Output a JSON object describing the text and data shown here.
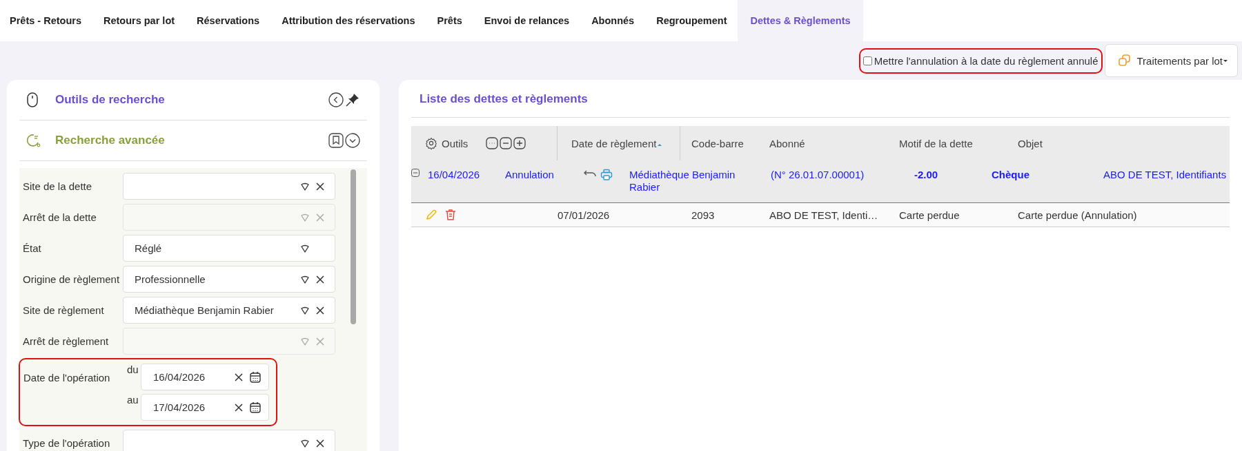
{
  "tabs": [
    {
      "label": "Prêts - Retours",
      "selected": false
    },
    {
      "label": "Retours par lot",
      "selected": false
    },
    {
      "label": "Réservations",
      "selected": false
    },
    {
      "label": "Attribution des réservations",
      "selected": false
    },
    {
      "label": "Prêts",
      "selected": false
    },
    {
      "label": "Envoi de relances",
      "selected": false
    },
    {
      "label": "Abonnés",
      "selected": false
    },
    {
      "label": "Regroupement",
      "selected": false
    },
    {
      "label": "Dettes & Règlements",
      "selected": true
    }
  ],
  "toolbar": {
    "option": {
      "label": "Mettre l'annulation à la date du règlement annulé",
      "checked": false,
      "highlighted": true
    },
    "batch_button": "Traitements par lot"
  },
  "search_panel": {
    "title": "Outils de recherche",
    "section_title": "Recherche avancée",
    "filters": [
      {
        "kind": "select",
        "label": "Site de la dette",
        "disabled": false,
        "clearable": true
      },
      {
        "kind": "select",
        "label": "Arrêt de la dette",
        "disabled": true,
        "clearable": true
      },
      {
        "kind": "select",
        "label": "État",
        "value": "Réglé",
        "disabled": false,
        "clearable": false
      },
      {
        "kind": "select",
        "label": "Origine de règlement",
        "value": "Professionnelle",
        "disabled": false,
        "clearable": true
      },
      {
        "kind": "select",
        "label": "Site de règlement",
        "value": "Médiathèque Benjamin Rabier",
        "disabled": false,
        "clearable": true
      },
      {
        "kind": "select",
        "label": "Arrêt de règlement",
        "disabled": true,
        "clearable": true
      },
      {
        "kind": "date_range",
        "label": "Date de l'opération",
        "from_label": "du",
        "from": "16/04/2026",
        "to_label": "au",
        "to": "17/04/2026",
        "highlighted": true
      },
      {
        "kind": "select",
        "label": "Type de l'opération",
        "disabled": false,
        "clearable": true
      }
    ]
  },
  "list": {
    "title": "Liste des dettes et règlements",
    "tools_label": "Outils",
    "columns": [
      {
        "label": "Date de règlement",
        "sorted": true
      },
      {
        "label": "Code-barre",
        "sorted": false
      },
      {
        "label": "Abonné",
        "sorted": false
      },
      {
        "label": "Motif de la dette",
        "sorted": false
      },
      {
        "label": "Objet",
        "sorted": false
      }
    ],
    "rows": [
      {
        "kind": "payment",
        "expanded": true,
        "date": "16/04/2026",
        "type": "Annulation",
        "site": "Médiathèque Benjamin Rabier",
        "account": "(N° 26.01.07.00001)",
        "amount": "-2.00",
        "mode": "Chèque",
        "patron": "ABO DE TEST, Identifiants"
      },
      {
        "kind": "debt",
        "date": "07/01/2026",
        "barcode": "2093",
        "patron": "ABO DE TEST, Identi…",
        "reason": "Carte perdue",
        "object": "Carte perdue (Annulation)"
      }
    ]
  }
}
